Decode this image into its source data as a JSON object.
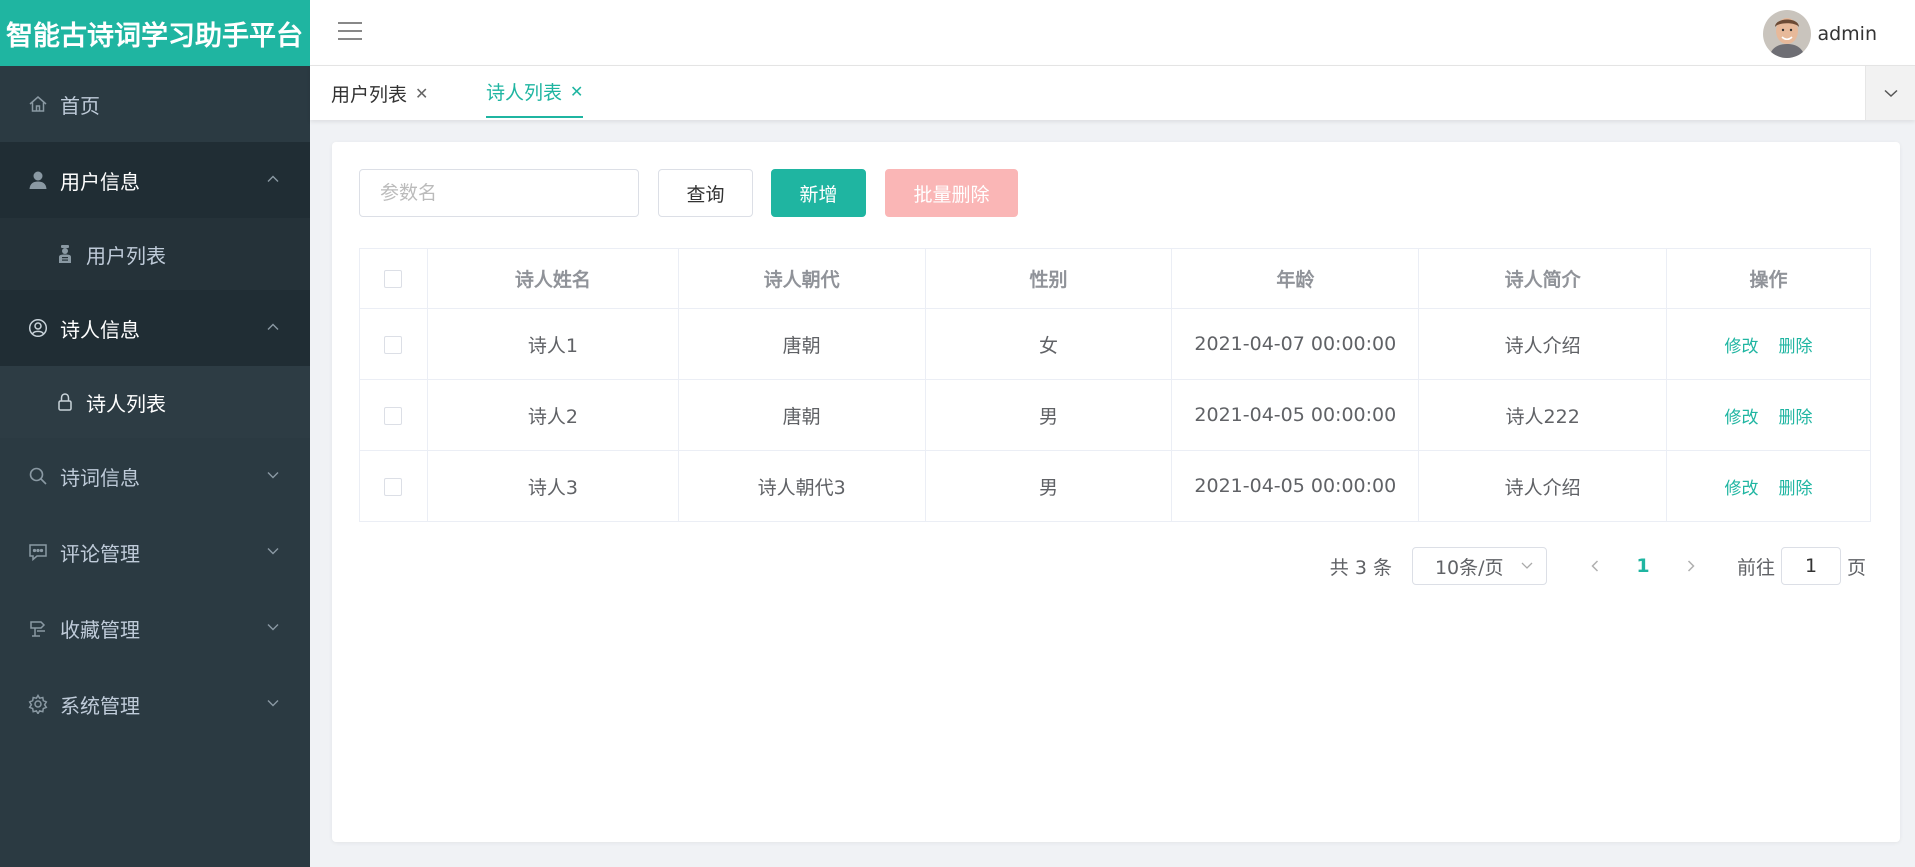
{
  "app": {
    "title": "智能古诗词学习助手平台"
  },
  "colors": {
    "accent": "#1fb5a1",
    "sidebar_bg": "#2b3a42",
    "danger_disabled": "#fab6b6"
  },
  "sidebar": {
    "items": [
      {
        "label": "首页",
        "icon": "home-icon"
      },
      {
        "label": "用户信息",
        "icon": "user-icon",
        "open": true,
        "children": [
          {
            "label": "用户列表",
            "icon": "user-list-icon"
          }
        ]
      },
      {
        "label": "诗人信息",
        "icon": "poet-icon",
        "open": true,
        "children": [
          {
            "label": "诗人列表",
            "icon": "lock-icon",
            "active": true
          }
        ]
      },
      {
        "label": "诗词信息",
        "icon": "search-icon"
      },
      {
        "label": "评论管理",
        "icon": "comment-icon"
      },
      {
        "label": "收藏管理",
        "icon": "favorite-icon"
      },
      {
        "label": "系统管理",
        "icon": "gear-icon"
      }
    ]
  },
  "header": {
    "username": "admin"
  },
  "tabs": [
    {
      "label": "用户列表",
      "active": false
    },
    {
      "label": "诗人列表",
      "active": true
    }
  ],
  "toolbar": {
    "search_placeholder": "参数名",
    "search_value": "",
    "query_label": "查询",
    "add_label": "新增",
    "batch_delete_label": "批量删除"
  },
  "table": {
    "headers": [
      "诗人姓名",
      "诗人朝代",
      "性别",
      "年龄",
      "诗人简介",
      "操作"
    ],
    "rows": [
      [
        "诗人1",
        "唐朝",
        "女",
        "2021-04-07 00:00:00",
        "诗人介绍"
      ],
      [
        "诗人2",
        "唐朝",
        "男",
        "2021-04-05 00:00:00",
        "诗人222"
      ],
      [
        "诗人3",
        "诗人朝代3",
        "男",
        "2021-04-05 00:00:00",
        "诗人介绍"
      ]
    ],
    "edit_label": "修改",
    "delete_label": "删除"
  },
  "pagination": {
    "total_text": "共 3 条",
    "page_size": "10条/页",
    "current_page": "1",
    "goto_prefix": "前往",
    "goto_value": "1",
    "goto_suffix": "页"
  }
}
